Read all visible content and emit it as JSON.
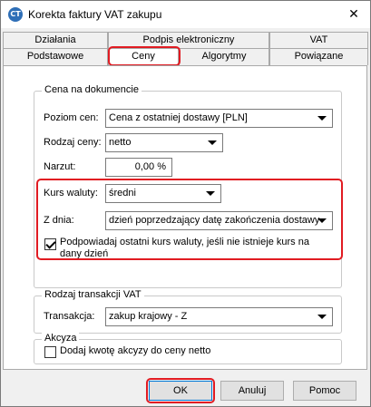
{
  "window": {
    "title": "Korekta faktury VAT zakupu",
    "icon_text": "CT"
  },
  "tabs_top": [
    "Działania",
    "Podpis elektroniczny",
    "VAT"
  ],
  "tabs_bottom": [
    "Podstawowe",
    "Ceny",
    "Algorytmy",
    "Powiązane"
  ],
  "active_tab": "Ceny",
  "cena_group": {
    "title": "Cena na dokumencie",
    "poziom_cen_label": "Poziom cen:",
    "poziom_cen_value": "Cena z ostatniej dostawy [PLN]",
    "rodzaj_ceny_label": "Rodzaj ceny:",
    "rodzaj_ceny_value": "netto",
    "narzut_label": "Narzut:",
    "narzut_value": "0,00 %",
    "kurs_waluty_label": "Kurs waluty:",
    "kurs_waluty_value": "średni",
    "z_dnia_label": "Z dnia:",
    "z_dnia_value": "dzień poprzedzający datę zakończenia dostawy",
    "podpowiadaj_label_line1": "Podpowiadaj ostatni kurs waluty, jeśli nie istnieje kurs na",
    "podpowiadaj_label_line2": "dany dzień",
    "podpowiadaj_checked": true
  },
  "vat_group": {
    "title": "Rodzaj transakcji VAT",
    "transakcja_label": "Transakcja:",
    "transakcja_value": "zakup krajowy - Z"
  },
  "akcyza_group": {
    "title": "Akcyza",
    "dodaj_label": "Dodaj kwotę akcyzy do ceny netto",
    "dodaj_checked": false
  },
  "buttons": {
    "ok": "OK",
    "anuluj": "Anuluj",
    "pomoc": "Pomoc"
  },
  "colors": {
    "highlight": "#e11b22",
    "default_button_border": "#0078d7"
  }
}
